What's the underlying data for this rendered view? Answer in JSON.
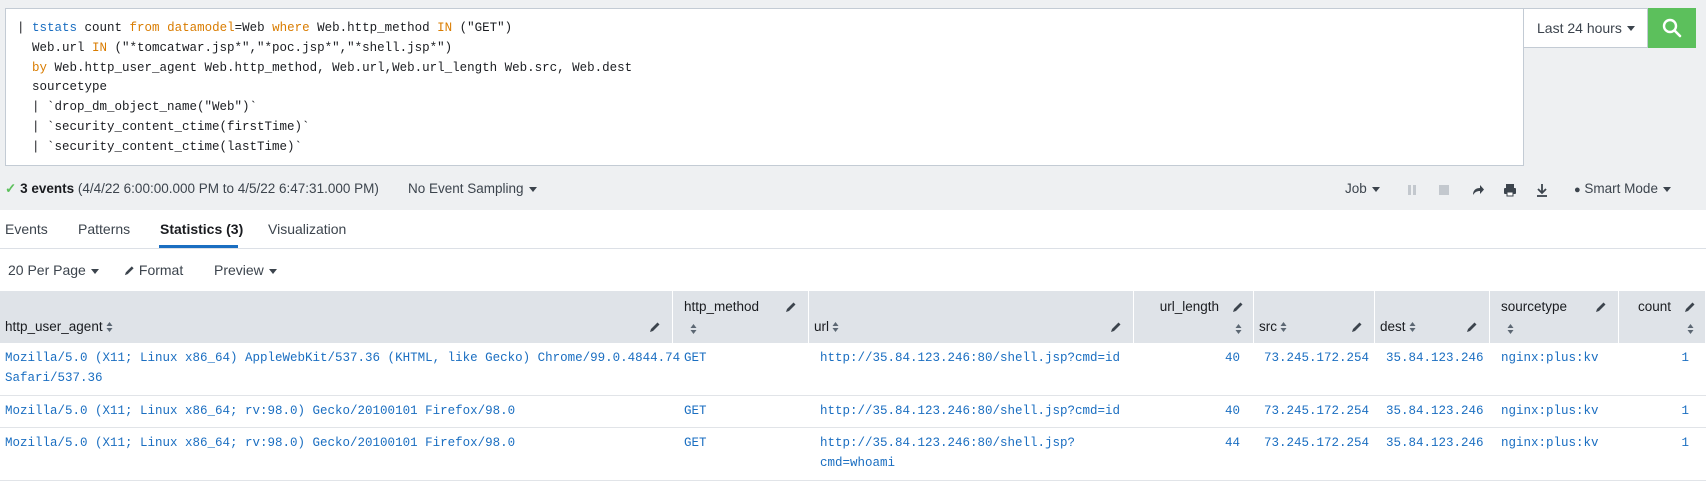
{
  "search": {
    "query_lines": [
      [
        "| ",
        {
          "t": "tstats",
          "c": "blue"
        },
        " count ",
        {
          "t": "from",
          "c": "orange"
        },
        " ",
        {
          "t": "datamodel",
          "c": "orange"
        },
        "=Web ",
        {
          "t": "where",
          "c": "orange"
        },
        " Web.http_method ",
        {
          "t": "IN",
          "c": "orange"
        },
        " (\"GET\")"
      ],
      [
        "  Web.url ",
        {
          "t": "IN",
          "c": "orange"
        },
        " (\"*tomcatwar.jsp*\",\"*poc.jsp*\",\"*shell.jsp*\")"
      ],
      [
        "  ",
        {
          "t": "by",
          "c": "orange"
        },
        " Web.http_user_agent Web.http_method, Web.url,Web.url_length Web.src, Web.dest"
      ],
      [
        "  sourcetype"
      ],
      [
        "  | `drop_dm_object_name(\"Web\")`"
      ],
      [
        "  | `security_content_ctime(firstTime)`"
      ],
      [
        "  | `security_content_ctime(lastTime)`"
      ]
    ],
    "time_range": "Last 24 hours",
    "search_icon": "magnifier-icon"
  },
  "jobbar": {
    "events": "3 events",
    "range": "(4/4/22 6:00:00.000 PM to 4/5/22 6:47:31.000 PM)",
    "sampling": "No Event Sampling",
    "job": "Job",
    "mode": "Smart Mode"
  },
  "tabs": [
    {
      "label": "Events"
    },
    {
      "label": "Patterns"
    },
    {
      "label": "Statistics (3)"
    },
    {
      "label": "Visualization"
    }
  ],
  "toolbar": {
    "per_page": "20 Per Page",
    "format": "Format",
    "preview": "Preview"
  },
  "table": {
    "columns": [
      "http_user_agent",
      "http_method",
      "url",
      "url_length",
      "src",
      "dest",
      "sourcetype",
      "count"
    ],
    "rows": [
      {
        "ua": [
          "Mozilla/5.0 (X11; Linux x86_64) AppleWebKit/537.36 (KHTML, like Gecko) Chrome/99.0.4844.74",
          "Safari/537.36"
        ],
        "method": "GET",
        "url": [
          "http://35.84.123.246:80/shell.jsp?cmd=id"
        ],
        "len": "40",
        "src": "73.245.172.254",
        "dest": "35.84.123.246",
        "st": "nginx:plus:kv",
        "count": "1"
      },
      {
        "ua": [
          "Mozilla/5.0 (X11; Linux x86_64; rv:98.0) Gecko/20100101 Firefox/98.0"
        ],
        "method": "GET",
        "url": [
          "http://35.84.123.246:80/shell.jsp?cmd=id"
        ],
        "len": "40",
        "src": "73.245.172.254",
        "dest": "35.84.123.246",
        "st": "nginx:plus:kv",
        "count": "1"
      },
      {
        "ua": [
          "Mozilla/5.0 (X11; Linux x86_64; rv:98.0) Gecko/20100101 Firefox/98.0"
        ],
        "method": "GET",
        "url": [
          "http://35.84.123.246:80/shell.jsp?",
          "cmd=whoami"
        ],
        "len": "44",
        "src": "73.245.172.254",
        "dest": "35.84.123.246",
        "st": "nginx:plus:kv",
        "count": "1"
      }
    ]
  },
  "colors": {
    "accent": "#1a6ec1",
    "keyword": "#d97c00",
    "search_button": "#5cc05c"
  }
}
